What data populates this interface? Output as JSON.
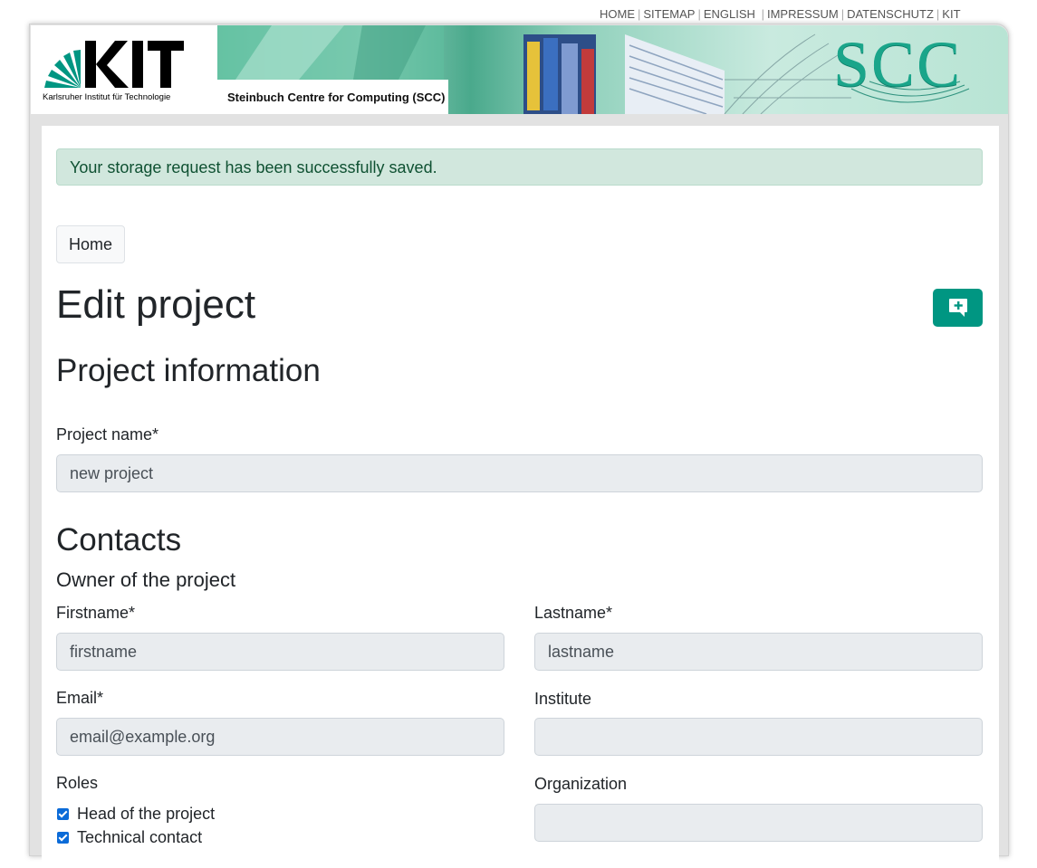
{
  "metanav": {
    "items": [
      "HOME",
      "SITEMAP",
      "ENGLISH",
      "IMPRESSUM",
      "DATENSCHUTZ",
      "KIT"
    ]
  },
  "header": {
    "kit_subtitle": "Karlsruher Institut für Technologie",
    "banner_label": "Steinbuch Centre for Computing (SCC)",
    "scc_logo": "SCC"
  },
  "alert": {
    "message": "Your storage request has been successfully saved."
  },
  "breadcrumb": {
    "home": "Home"
  },
  "page_title": "Edit project",
  "project_info": {
    "heading": "Project information",
    "name_label": "Project name*",
    "name_value": "new project"
  },
  "contacts": {
    "heading": "Contacts",
    "owner_heading": "Owner of the project",
    "firstname_label": "Firstname*",
    "firstname_value": "firstname",
    "lastname_label": "Lastname*",
    "lastname_value": "lastname",
    "email_label": "Email*",
    "email_value": "email@example.org",
    "institute_label": "Institute",
    "institute_value": "",
    "roles_label": "Roles",
    "roles": [
      "Head of the project",
      "Technical contact"
    ],
    "organization_label": "Organization",
    "organization_value": ""
  },
  "colors": {
    "accent": "#009682",
    "alert_bg": "#d1e7dd",
    "alert_text": "#0f5132",
    "field_bg": "#e9ecef"
  },
  "icons": {
    "feedback": "comment-plus-icon",
    "kit_logo": "kit-logo-icon"
  }
}
